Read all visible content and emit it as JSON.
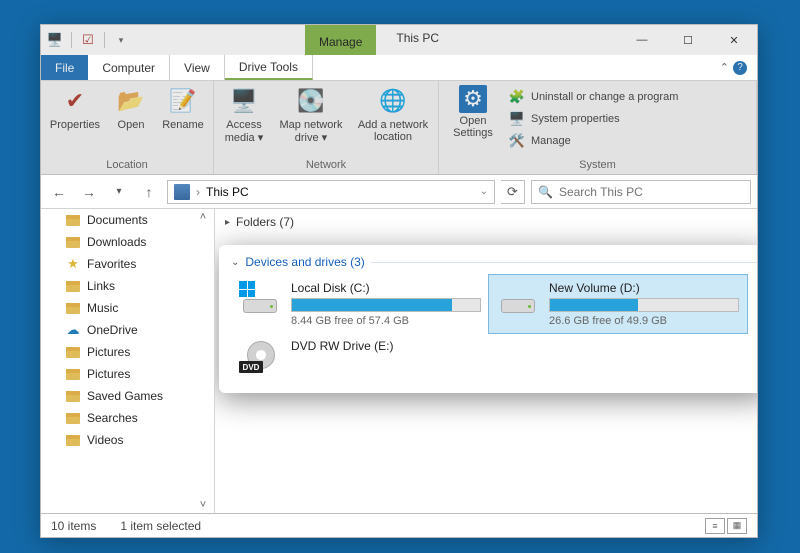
{
  "title": "This PC",
  "manage_tab": "Manage",
  "tabs": {
    "file": "File",
    "computer": "Computer",
    "view": "View",
    "drive_tools": "Drive Tools"
  },
  "ribbon": {
    "properties": "Properties",
    "open": "Open",
    "rename": "Rename",
    "access_media": "Access media ▾",
    "map_drive": "Map network drive ▾",
    "add_location": "Add a network location",
    "open_settings": "Open Settings",
    "uninstall": "Uninstall or change a program",
    "sys_props": "System properties",
    "manage": "Manage",
    "group_location": "Location",
    "group_network": "Network",
    "group_system": "System"
  },
  "address": {
    "location": "This PC",
    "search_placeholder": "Search This PC"
  },
  "sidebar": {
    "items": [
      {
        "label": "Documents",
        "icon": "folder"
      },
      {
        "label": "Downloads",
        "icon": "folder"
      },
      {
        "label": "Favorites",
        "icon": "star"
      },
      {
        "label": "Links",
        "icon": "folder"
      },
      {
        "label": "Music",
        "icon": "folder"
      },
      {
        "label": "OneDrive",
        "icon": "cloud"
      },
      {
        "label": "Pictures",
        "icon": "folder"
      },
      {
        "label": "Pictures",
        "icon": "folder"
      },
      {
        "label": "Saved Games",
        "icon": "folder"
      },
      {
        "label": "Searches",
        "icon": "folder"
      },
      {
        "label": "Videos",
        "icon": "folder"
      }
    ]
  },
  "folders_header": "Folders (7)",
  "devices": {
    "header": "Devices and drives (3)",
    "c": {
      "name": "Local Disk (C:)",
      "free_text": "8.44 GB free of 57.4 GB",
      "used_pct": 85
    },
    "d": {
      "name": "New Volume (D:)",
      "free_text": "26.6 GB free of 49.9 GB",
      "used_pct": 47
    },
    "e": {
      "name": "DVD RW Drive (E:)"
    }
  },
  "status": {
    "count": "10 items",
    "selected": "1 item selected"
  }
}
